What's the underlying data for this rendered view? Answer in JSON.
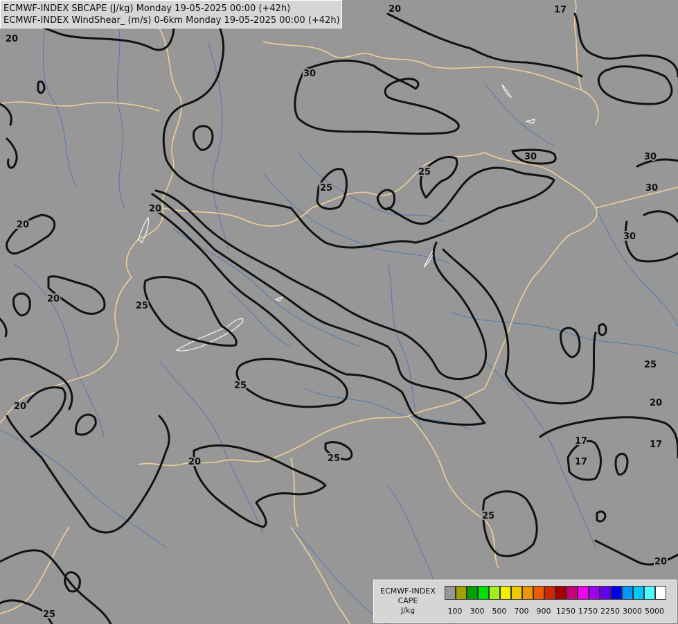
{
  "header": {
    "line1": "ECMWF-INDEX SBCAPE (J/kg) Monday 19-05-2025 00:00 (+42h)",
    "line2": "ECMWF-INDEX WindShear_ (m/s) 0-6km Monday 19-05-2025 00:00 (+42h)"
  },
  "map": {
    "background_color": "#979797",
    "contour_color": "#111111",
    "border_color": "#efcf9a",
    "river_color": "#3f6fb6",
    "contour_labels": [
      "20",
      "17",
      "30",
      "20",
      "30",
      "25",
      "25",
      "30",
      "30",
      "20",
      "20",
      "30",
      "20",
      "25",
      "17",
      "25",
      "25",
      "20",
      "20",
      "20",
      "17",
      "17",
      "25",
      "25",
      "20",
      "25"
    ]
  },
  "legend": {
    "title_line1": "ECMWF-INDEX",
    "title_line2": "CAPE",
    "title_line3": "J/kg",
    "colors": [
      "#979797",
      "#a0a000",
      "#00a000",
      "#00e000",
      "#a0f020",
      "#f0f000",
      "#f0c800",
      "#f09600",
      "#f05a00",
      "#d22800",
      "#a00000",
      "#c80078",
      "#f000f0",
      "#a000f0",
      "#6400f0",
      "#0000f0",
      "#0096ff",
      "#00c8ff",
      "#50ffff",
      "#ffffff"
    ],
    "labels": [
      "100",
      "300",
      "500",
      "700",
      "900",
      "1250",
      "1750",
      "2250",
      "3000",
      "5000"
    ]
  }
}
